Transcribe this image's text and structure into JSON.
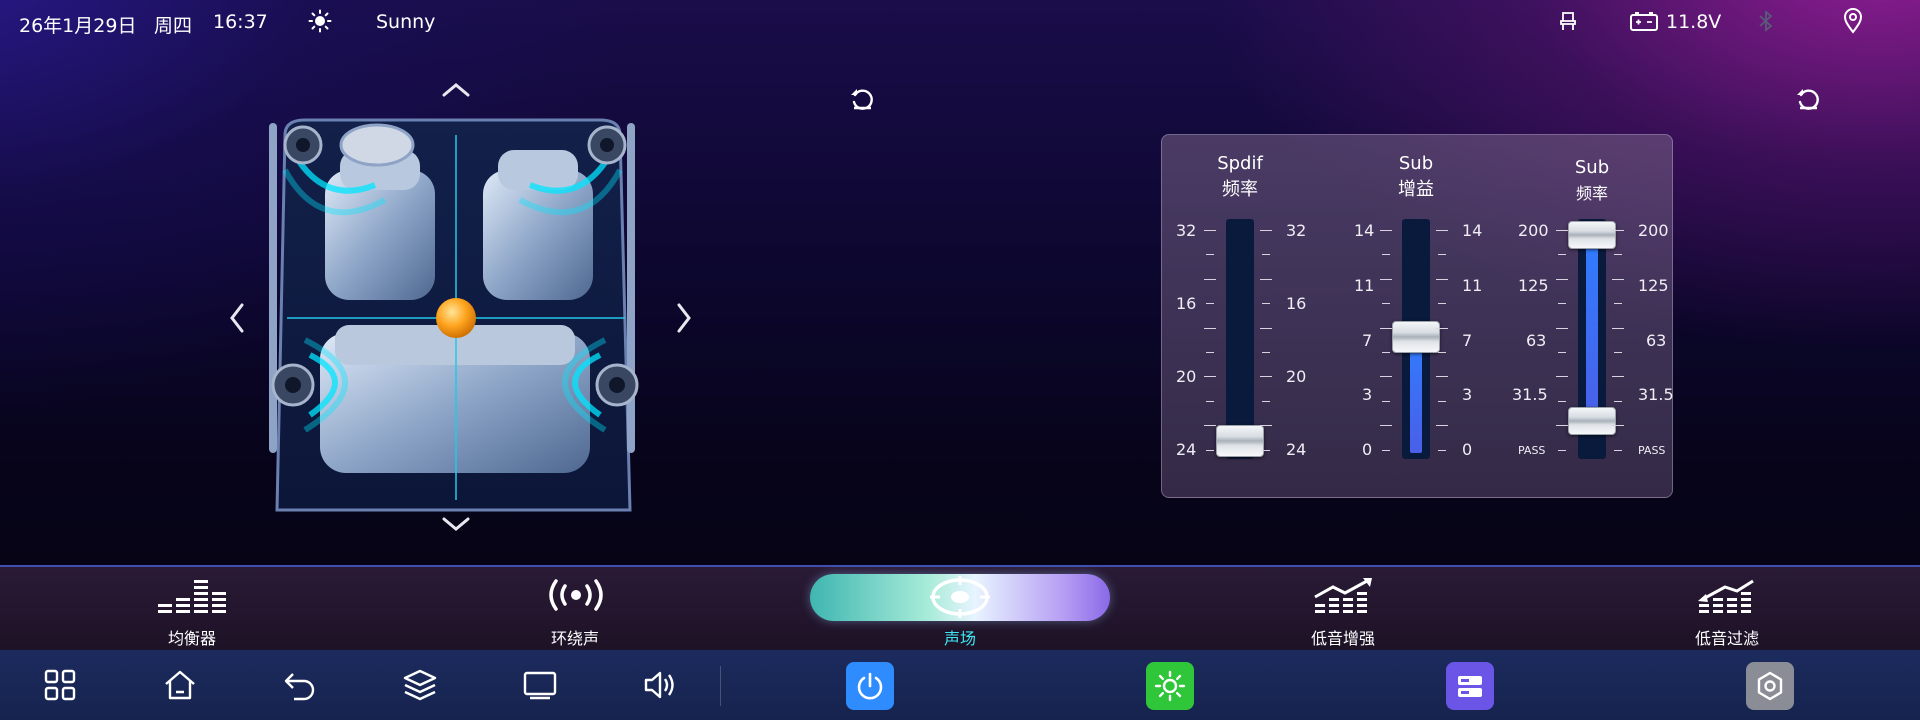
{
  "status_bar": {
    "date": "26年1月29日",
    "weekday": "周四",
    "time": "16:37",
    "weather_icon": "sun-icon",
    "weather": "Sunny",
    "seat_icon": "seat-icon",
    "battery_icon": "battery-icon",
    "voltage": "11.8V",
    "bluetooth_icon": "bluetooth-icon",
    "location_icon": "location-icon"
  },
  "sound_field": {
    "reset_icon": "reset-icon",
    "arrows": [
      "chevron-up-icon",
      "chevron-down-icon",
      "chevron-left-icon",
      "chevron-right-icon"
    ]
  },
  "sliders_panel": {
    "reset_icon": "reset-icon",
    "sliders": [
      {
        "title_line1": "Spdif",
        "title_line2": "频率",
        "ticks": [
          "32",
          "16",
          "20",
          "24"
        ],
        "value_fraction": 0.0
      },
      {
        "title_line1": "Sub",
        "title_line2": "增益",
        "ticks": [
          "14",
          "11",
          "7",
          "3",
          "0"
        ],
        "value_fraction": 0.5
      },
      {
        "title_line1": "Sub",
        "title_line2": "频率",
        "ticks": [
          "200",
          "125",
          "63",
          "31.5",
          "PASS"
        ],
        "value_fraction_top": 1.0,
        "value_fraction_bottom": 0.12
      }
    ]
  },
  "tabs": [
    {
      "label": "均衡器",
      "icon": "equalizer-icon",
      "active": false
    },
    {
      "label": "环绕声",
      "icon": "surround-icon",
      "active": false
    },
    {
      "label": "声场",
      "icon": "sound-field-icon",
      "active": true
    },
    {
      "label": "低音增强",
      "icon": "bass-boost-icon",
      "active": false
    },
    {
      "label": "低音过滤",
      "icon": "bass-filter-icon",
      "active": false
    }
  ],
  "dock": {
    "icons": [
      "apps-grid-icon",
      "home-icon",
      "back-icon",
      "layers-icon",
      "screen-icon",
      "volume-icon"
    ],
    "apps": [
      {
        "icon": "power-icon",
        "color": "#2f8cff"
      },
      {
        "icon": "brightness-icon",
        "color": "#2fc63a"
      },
      {
        "icon": "storage-icon",
        "color": "#6a55e6"
      },
      {
        "icon": "settings-hex-icon",
        "color": "#8a8d96"
      }
    ]
  },
  "colors": {
    "accent": "#3ee6f2",
    "slider_fill": "#2f7dff",
    "tab_border": "#3f4fae"
  }
}
